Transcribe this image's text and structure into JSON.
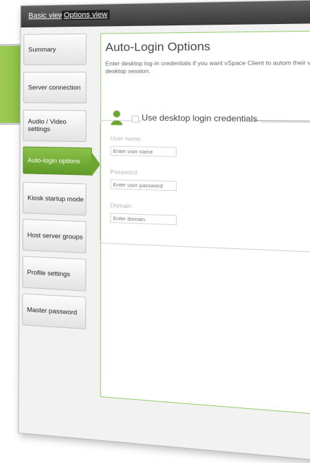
{
  "tabs": {
    "basic": "Basic view",
    "options": "Options view"
  },
  "nav": {
    "items": [
      {
        "label": "Summary"
      },
      {
        "label": "Server connection"
      },
      {
        "label": "Audio / Video settings"
      },
      {
        "label": "Auto-login options",
        "selected": true
      },
      {
        "label": "Kiosk startup mode"
      },
      {
        "label": "Host server groups"
      },
      {
        "label": "Profile settings"
      },
      {
        "label": "Master password"
      }
    ]
  },
  "panel": {
    "title": "Auto-Login Options",
    "description": "Enter desktop log-in credentials if you want vSpace Client to autom their virtual desktop session.",
    "checkbox_label": "Use desktop login credentials",
    "fields": [
      {
        "label": "User name:",
        "placeholder": "Enter user name"
      },
      {
        "label": "Password:",
        "placeholder": "Enter user password"
      },
      {
        "label": "Domain:",
        "placeholder": "Enter domain"
      }
    ]
  },
  "colors": {
    "accent": "#6ea632",
    "border": "#8fd06a"
  },
  "icons": {
    "user": "user-icon"
  }
}
